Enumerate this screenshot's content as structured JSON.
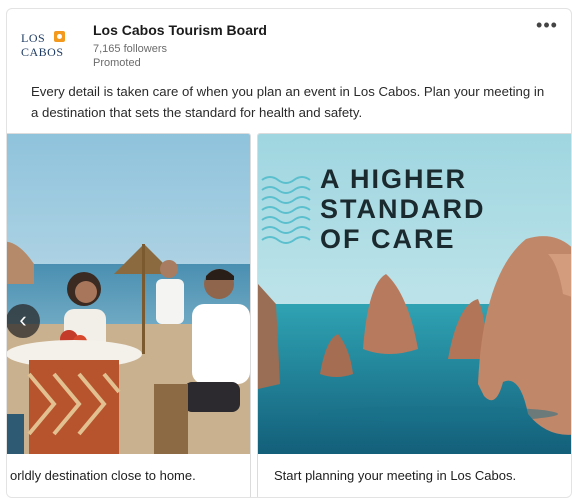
{
  "post": {
    "company": "Los Cabos Tourism Board",
    "followers": "7,165 followers",
    "promoted": "Promoted",
    "caption": "Every detail is taken care of when you plan an event in Los Cabos. Plan your meeting in a destination that sets the standard for health and safety.",
    "logo": {
      "line1": "LOS",
      "line2": "CABOS"
    },
    "menu_label": "•••"
  },
  "carousel": {
    "prev_label": "‹",
    "slides": [
      {
        "footer": "orldly destination close to home.",
        "image": "people dining outdoors by the sea"
      },
      {
        "footer": "Start planning your meeting in Los Cabos.",
        "headline_lines": [
          "A HIGHER",
          "STANDARD",
          "OF CARE"
        ],
        "image": "rock arches in turquoise sea"
      }
    ]
  },
  "colors": {
    "accent": "#f39a1e",
    "brand_navy": "#1f3b63",
    "sea": "#2fa3b3"
  }
}
